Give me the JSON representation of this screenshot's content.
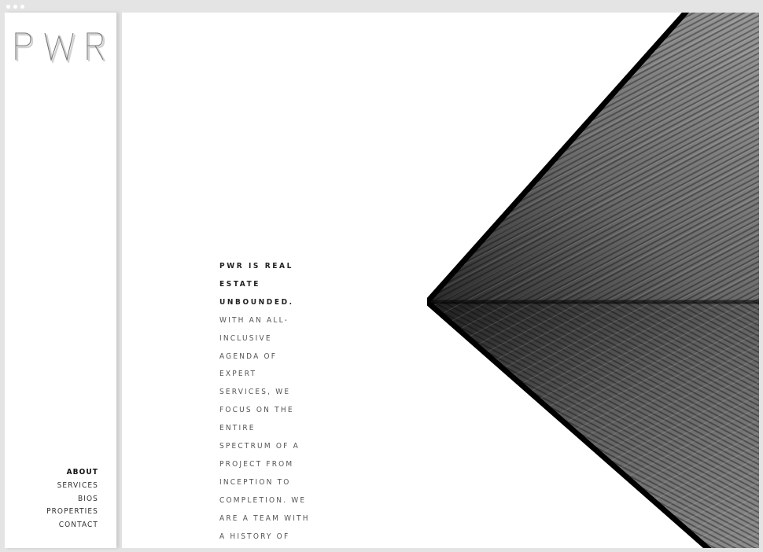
{
  "brand": {
    "logo_text": "PWR"
  },
  "nav": {
    "items": [
      {
        "label": "ABOUT",
        "active": true
      },
      {
        "label": "SERVICES",
        "active": false
      },
      {
        "label": "BIOS",
        "active": false
      },
      {
        "label": "PROPERTIES",
        "active": false
      },
      {
        "label": "CONTACT",
        "active": false
      }
    ]
  },
  "intro": {
    "lead_lines": [
      "PWR IS REAL",
      "ESTATE",
      "UNBOUNDED."
    ],
    "body_lines": [
      "WITH AN ALL-",
      "INCLUSIVE",
      "AGENDA OF",
      "EXPERT",
      "SERVICES, WE",
      "FOCUS ON THE",
      "ENTIRE",
      "SPECTRUM OF A",
      "PROJECT FROM",
      "INCEPTION TO",
      "COMPLETION. WE",
      "ARE A TEAM WITH",
      "A HISTORY OF"
    ]
  },
  "hero": {
    "image_name": "building-facade-photo"
  },
  "colors": {
    "text": "#555555",
    "lead": "#222222",
    "frame": "#e4e4e4"
  }
}
